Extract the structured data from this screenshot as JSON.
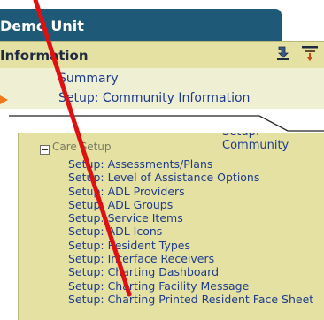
{
  "top_panel": {
    "tab_title": "Demo Unit",
    "section_title": "Information",
    "menu": [
      {
        "label": "Summary"
      },
      {
        "label": "Setup: Community Information"
      }
    ],
    "icons": [
      "export-icon",
      "filter-sort-icon"
    ]
  },
  "bottom_panel": {
    "cut_off_text": "Setup: Community",
    "section_label": "Care Setup",
    "items": [
      "Setup: Assessments/Plans",
      "Setup: Level of Assistance Options",
      "Setup: ADL Providers",
      "Setup: ADL Groups",
      "Setup: Service Items",
      "Setup: ADL Icons",
      "Setup: Resident Types",
      "Setup: Interface Receivers",
      "Setup: Charting Dashboard",
      "Setup: Charting Facility Message",
      "Setup: Charting Printed Resident Face Sheet"
    ]
  },
  "colors": {
    "tab_bg": "#1e5a78",
    "panel_bg": "#e4e1a2",
    "link": "#1e3c8e",
    "arrow": "#f07818",
    "annotation": "#e01010"
  }
}
